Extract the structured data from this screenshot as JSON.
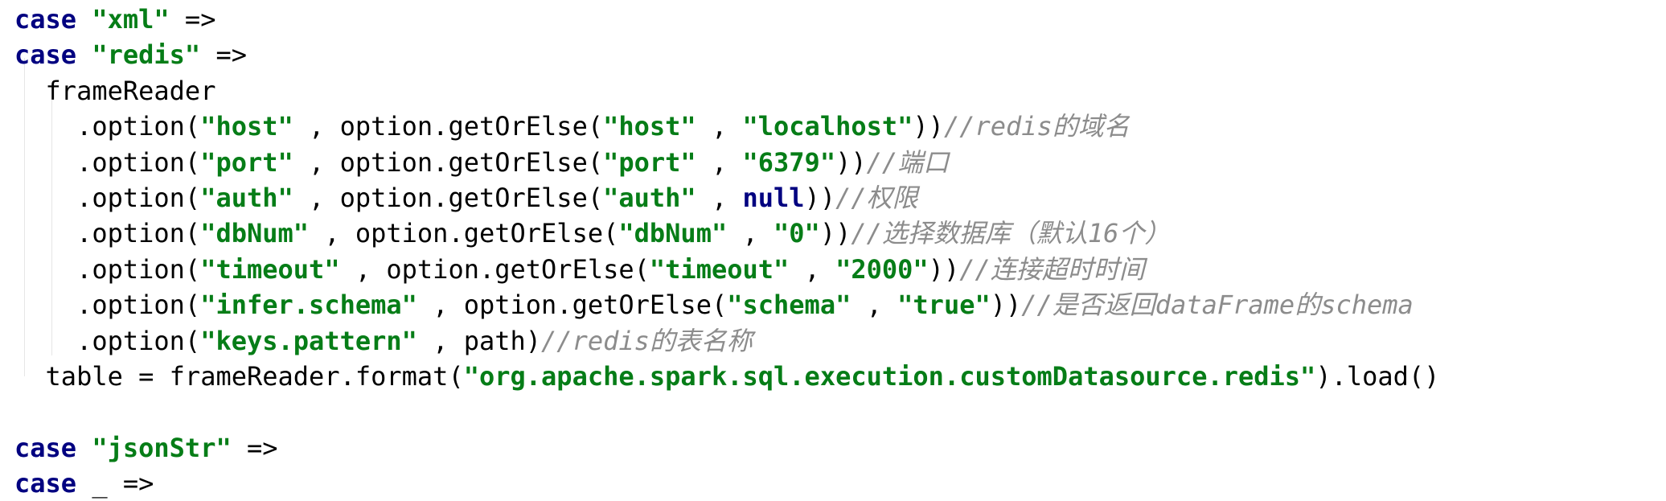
{
  "editor": {
    "lines": [
      {
        "tokens": [
          {
            "t": "case",
            "c": "kw"
          },
          {
            "t": " ",
            "c": ""
          },
          {
            "t": "\"xml\"",
            "c": "str"
          },
          {
            "t": " =>",
            "c": ""
          }
        ]
      },
      {
        "tokens": [
          {
            "t": "case",
            "c": "kw"
          },
          {
            "t": " ",
            "c": ""
          },
          {
            "t": "\"redis\"",
            "c": "str"
          },
          {
            "t": " =>",
            "c": ""
          }
        ]
      },
      {
        "tokens": [
          {
            "t": "  frameReader",
            "c": ""
          }
        ]
      },
      {
        "tokens": [
          {
            "t": "    .option(",
            "c": ""
          },
          {
            "t": "\"host\"",
            "c": "str"
          },
          {
            "t": " , option.getOrElse(",
            "c": ""
          },
          {
            "t": "\"host\"",
            "c": "str"
          },
          {
            "t": " , ",
            "c": ""
          },
          {
            "t": "\"localhost\"",
            "c": "str"
          },
          {
            "t": "))",
            "c": ""
          },
          {
            "t": "//redis的域名",
            "c": "cm"
          }
        ]
      },
      {
        "tokens": [
          {
            "t": "    .option(",
            "c": ""
          },
          {
            "t": "\"port\"",
            "c": "str"
          },
          {
            "t": " , option.getOrElse(",
            "c": ""
          },
          {
            "t": "\"port\"",
            "c": "str"
          },
          {
            "t": " , ",
            "c": ""
          },
          {
            "t": "\"6379\"",
            "c": "str"
          },
          {
            "t": "))",
            "c": ""
          },
          {
            "t": "//端口",
            "c": "cm"
          }
        ]
      },
      {
        "tokens": [
          {
            "t": "    .option(",
            "c": ""
          },
          {
            "t": "\"auth\"",
            "c": "str"
          },
          {
            "t": " , option.getOrElse(",
            "c": ""
          },
          {
            "t": "\"auth\"",
            "c": "str"
          },
          {
            "t": " , ",
            "c": ""
          },
          {
            "t": "null",
            "c": "kw"
          },
          {
            "t": "))",
            "c": ""
          },
          {
            "t": "//权限",
            "c": "cm"
          }
        ]
      },
      {
        "tokens": [
          {
            "t": "    .option(",
            "c": ""
          },
          {
            "t": "\"dbNum\"",
            "c": "str"
          },
          {
            "t": " , option.getOrElse(",
            "c": ""
          },
          {
            "t": "\"dbNum\"",
            "c": "str"
          },
          {
            "t": " , ",
            "c": ""
          },
          {
            "t": "\"0\"",
            "c": "str"
          },
          {
            "t": "))",
            "c": ""
          },
          {
            "t": "//选择数据库（默认16个）",
            "c": "cm"
          }
        ]
      },
      {
        "tokens": [
          {
            "t": "    .option(",
            "c": ""
          },
          {
            "t": "\"timeout\"",
            "c": "str"
          },
          {
            "t": " , option.getOrElse(",
            "c": ""
          },
          {
            "t": "\"timeout\"",
            "c": "str"
          },
          {
            "t": " , ",
            "c": ""
          },
          {
            "t": "\"2000\"",
            "c": "str"
          },
          {
            "t": "))",
            "c": ""
          },
          {
            "t": "//连接超时时间",
            "c": "cm"
          }
        ]
      },
      {
        "tokens": [
          {
            "t": "    .option(",
            "c": ""
          },
          {
            "t": "\"infer.schema\"",
            "c": "str"
          },
          {
            "t": " , option.getOrElse(",
            "c": ""
          },
          {
            "t": "\"schema\"",
            "c": "str"
          },
          {
            "t": " , ",
            "c": ""
          },
          {
            "t": "\"true\"",
            "c": "str"
          },
          {
            "t": "))",
            "c": ""
          },
          {
            "t": "//是否返回dataFrame的schema",
            "c": "cm"
          }
        ]
      },
      {
        "tokens": [
          {
            "t": "    .option(",
            "c": ""
          },
          {
            "t": "\"keys.pattern\"",
            "c": "str"
          },
          {
            "t": " , path)",
            "c": ""
          },
          {
            "t": "//redis的表名称",
            "c": "cm"
          }
        ]
      },
      {
        "tokens": [
          {
            "t": "  table = frameReader.format(",
            "c": ""
          },
          {
            "t": "\"org.apache.spark.sql.execution.customDatasource.redis\"",
            "c": "str"
          },
          {
            "t": ").load()",
            "c": ""
          }
        ]
      },
      {
        "tokens": []
      },
      {
        "tokens": [
          {
            "t": "case",
            "c": "kw"
          },
          {
            "t": " ",
            "c": ""
          },
          {
            "t": "\"jsonStr\"",
            "c": "str"
          },
          {
            "t": " =>",
            "c": ""
          }
        ]
      },
      {
        "tokens": [
          {
            "t": "case",
            "c": "kw"
          },
          {
            "t": " _ =>",
            "c": ""
          }
        ]
      }
    ]
  }
}
